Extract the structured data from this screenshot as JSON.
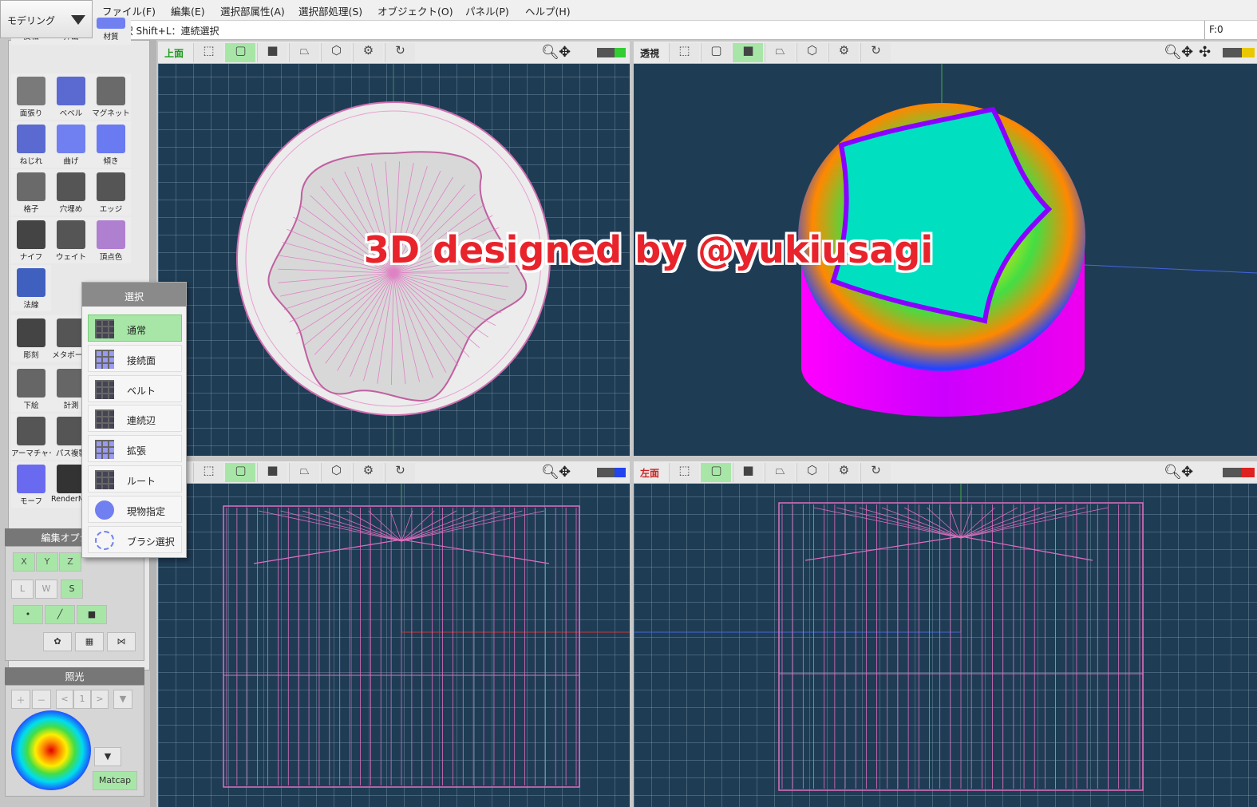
{
  "mode_selector": {
    "label": "モデリング"
  },
  "menu": [
    "ファイル(F)",
    "編集(E)",
    "選択部属性(A)",
    "選択部処理(S)",
    "オブジェクト(O)",
    "パネル(P)",
    "ヘルプ(H)"
  ],
  "status": {
    "hint": "L：選択  Shift+L：連続選択",
    "frame": "F:0"
  },
  "tools": [
    {
      "label": "反転",
      "icon": "flip-icon"
    },
    {
      "label": "押出",
      "icon": "extrude-icon"
    },
    {
      "label": "材質",
      "icon": "material-icon"
    },
    {
      "label": "面張り",
      "icon": "face-fill-icon"
    },
    {
      "label": "ベベル",
      "icon": "bevel-icon"
    },
    {
      "label": "マグネット",
      "icon": "magnet-icon"
    },
    {
      "label": "ねじれ",
      "icon": "twist-icon"
    },
    {
      "label": "曲げ",
      "icon": "bend-icon"
    },
    {
      "label": "傾き",
      "icon": "tilt-icon"
    },
    {
      "label": "格子",
      "icon": "lattice-icon"
    },
    {
      "label": "穴埋め",
      "icon": "fill-hole-icon"
    },
    {
      "label": "エッジ",
      "icon": "edge-icon"
    },
    {
      "label": "ナイフ",
      "icon": "knife-icon"
    },
    {
      "label": "ウェイト",
      "icon": "weight-icon"
    },
    {
      "label": "頂点色",
      "icon": "vertex-color-icon"
    },
    {
      "label": "法線",
      "icon": "normal-icon"
    },
    {
      "label": "彫刻",
      "icon": "sculpt-icon"
    },
    {
      "label": "メタボール",
      "icon": "metaball-icon"
    },
    {
      "label": "下絵",
      "icon": "underlay-icon"
    },
    {
      "label": "計測",
      "icon": "measure-icon"
    },
    {
      "label": "アーマチャー",
      "icon": "armature-icon"
    },
    {
      "label": "パス複製",
      "icon": "path-duplicate-icon"
    },
    {
      "label": "モーフ",
      "icon": "morph-icon"
    },
    {
      "label": "RenderMan",
      "icon": "renderman-icon"
    }
  ],
  "edit_options": {
    "title": "編集オプション",
    "axes": [
      "X",
      "Y",
      "Z"
    ],
    "modes": [
      "L",
      "W",
      "S"
    ]
  },
  "lighting": {
    "title": "照光",
    "page": "1",
    "matcap_label": "Matcap"
  },
  "select_popup": {
    "title": "選択",
    "items": [
      "通常",
      "接続面",
      "ベルト",
      "連続辺",
      "拡張",
      "ルート",
      "現物指定",
      "ブラシ選択"
    ]
  },
  "viewports": [
    {
      "title": "上面",
      "title_color": "#1a9c1a",
      "indicator_color": "#33cc33"
    },
    {
      "title": "透視",
      "title_color": "#222222",
      "indicator_color": "#e8c800"
    },
    {
      "title": "",
      "title_color": "#2244cc",
      "indicator_color": "#2244ee"
    },
    {
      "title": "左面",
      "title_color": "#cc2222",
      "indicator_color": "#dd2222"
    }
  ],
  "watermark": "3D designed by @yukiusagi",
  "colors": {
    "viewport_bg": "#1f3c55",
    "wire": "#e06ec0",
    "accent_green": "#a8e6a8"
  }
}
